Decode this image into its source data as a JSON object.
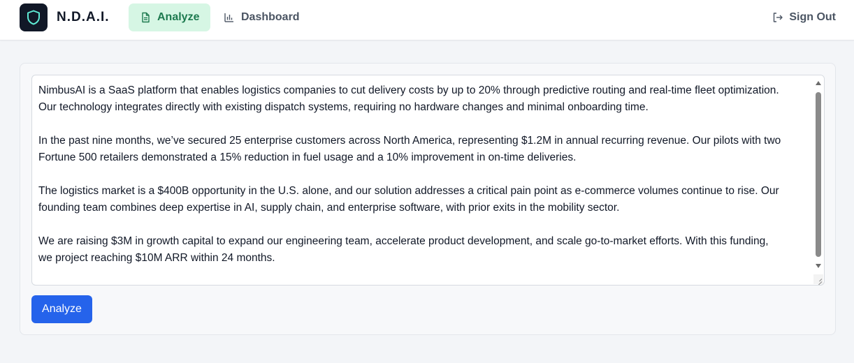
{
  "brand": {
    "name": "N.D.A.I.",
    "logo_icon": "shield-icon"
  },
  "nav": {
    "tabs": [
      {
        "label": "Analyze",
        "icon": "document-icon",
        "active": true
      },
      {
        "label": "Dashboard",
        "icon": "bar-chart-icon",
        "active": false
      }
    ],
    "sign_out_label": "Sign Out",
    "sign_out_icon": "logout-icon"
  },
  "editor": {
    "value": "NimbusAI is a SaaS platform that enables logistics companies to cut delivery costs by up to 20% through predictive routing and real-time fleet optimization.\nOur technology integrates directly with existing dispatch systems, requiring no hardware changes and minimal onboarding time.\n\nIn the past nine months, we’ve secured 25 enterprise customers across North America, representing $1.2M in annual recurring revenue. Our pilots with two\nFortune 500 retailers demonstrated a 15% reduction in fuel usage and a 10% improvement in on-time deliveries.\n\nThe logistics market is a $400B opportunity in the U.S. alone, and our solution addresses a critical pain point as e-commerce volumes continue to rise. Our\nfounding team combines deep expertise in AI, supply chain, and enterprise software, with prior exits in the mobility sector.\n\nWe are raising $3M in growth capital to expand our engineering team, accelerate product development, and scale go-to-market efforts. With this funding,\nwe project reaching $10M ARR within 24 months."
  },
  "actions": {
    "analyze_label": "Analyze"
  },
  "colors": {
    "primary_button": "#2563eb",
    "active_tab_bg": "#d6f6e4",
    "active_tab_text": "#1d7a4f",
    "logo_bg": "#111827",
    "logo_accent": "#5eead4"
  }
}
